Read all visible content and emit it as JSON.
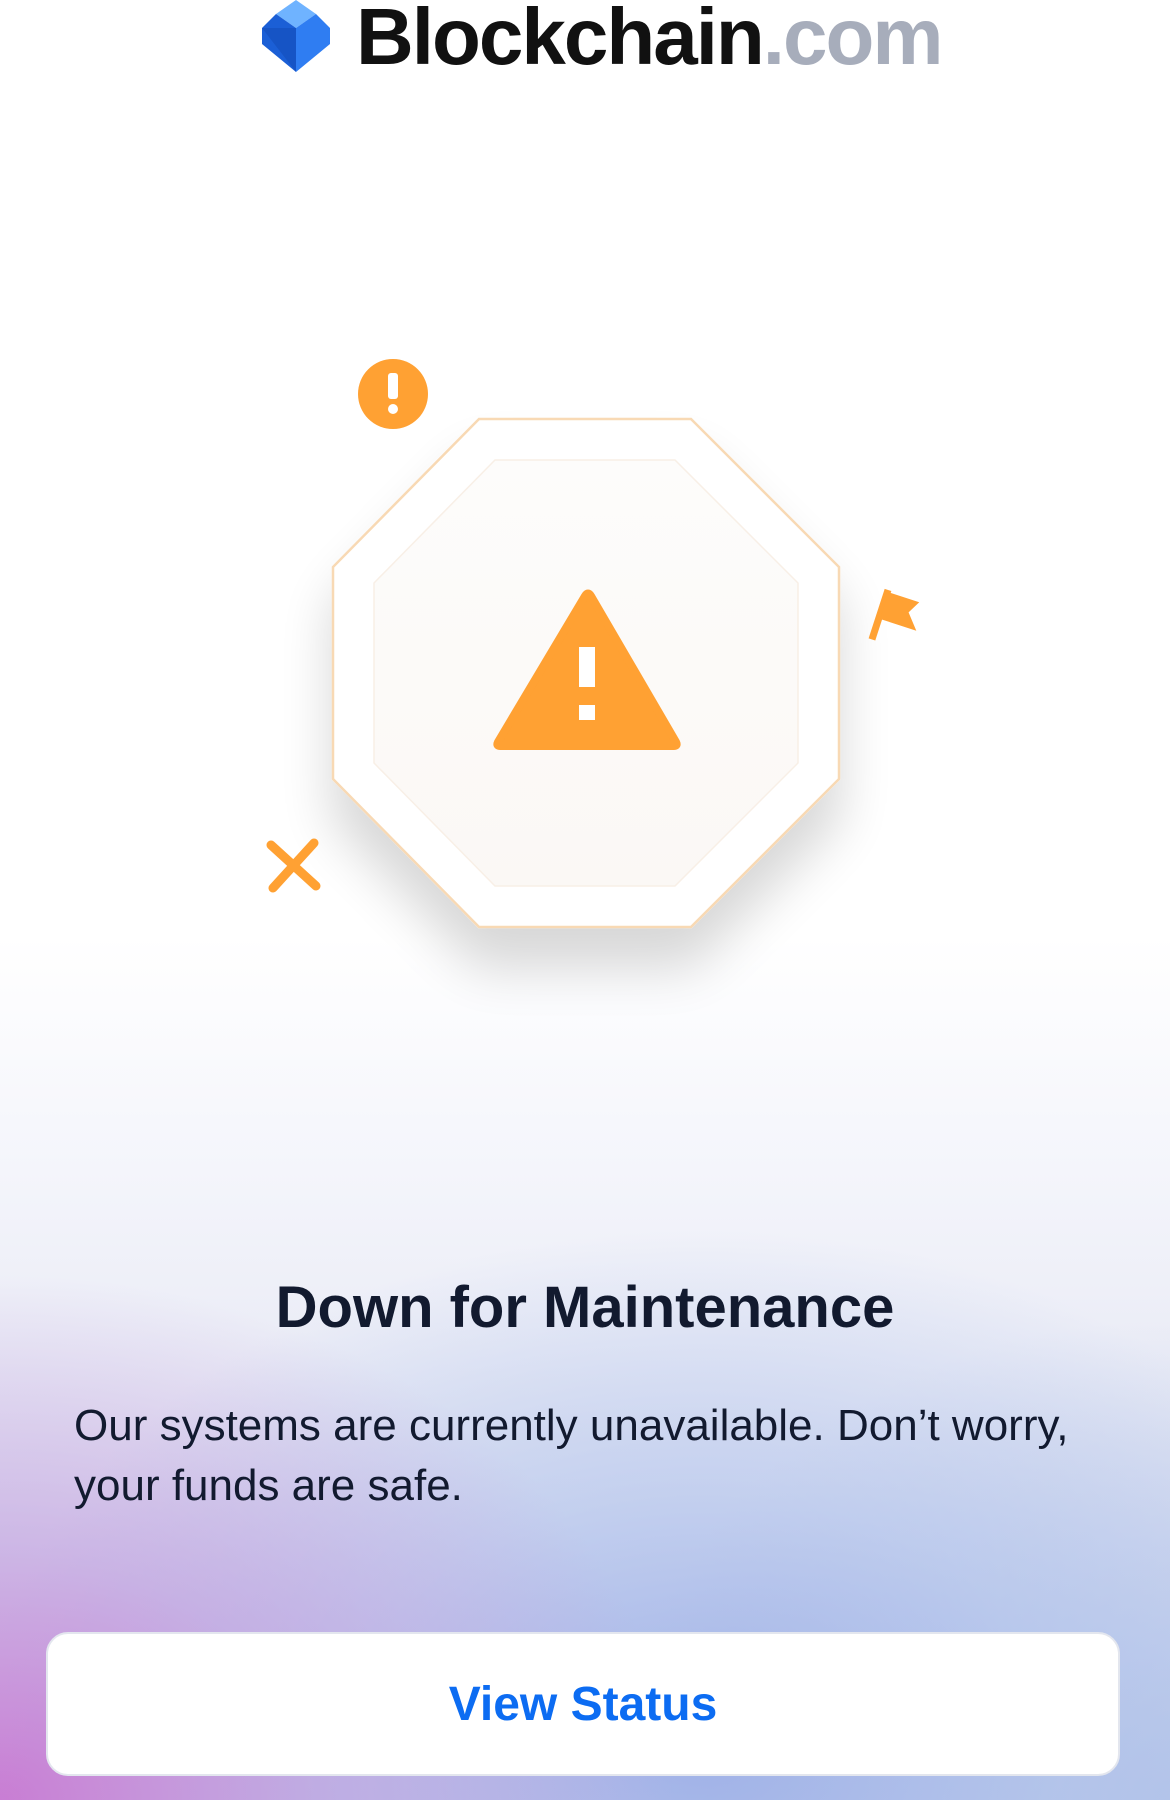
{
  "header": {
    "logo_icon": "blockchain-cube-logo-icon",
    "brand_name": "Blockchain",
    "brand_tld": ".com"
  },
  "illustration": {
    "main_icon": "warning-triangle-icon",
    "decorations": [
      "exclamation-circle-icon",
      "flag-icon",
      "x-mark-icon"
    ],
    "accent_color": "#ffa133"
  },
  "main": {
    "title": "Down for Maintenance",
    "description": "Our systems are currently unavailable. Don’t worry, your funds are safe.",
    "view_status_label": "View Status"
  },
  "colors": {
    "accent": "#ffa133",
    "link": "#0c6cf2",
    "text": "#121a2f",
    "brand_blue": "#0c6cf2"
  }
}
